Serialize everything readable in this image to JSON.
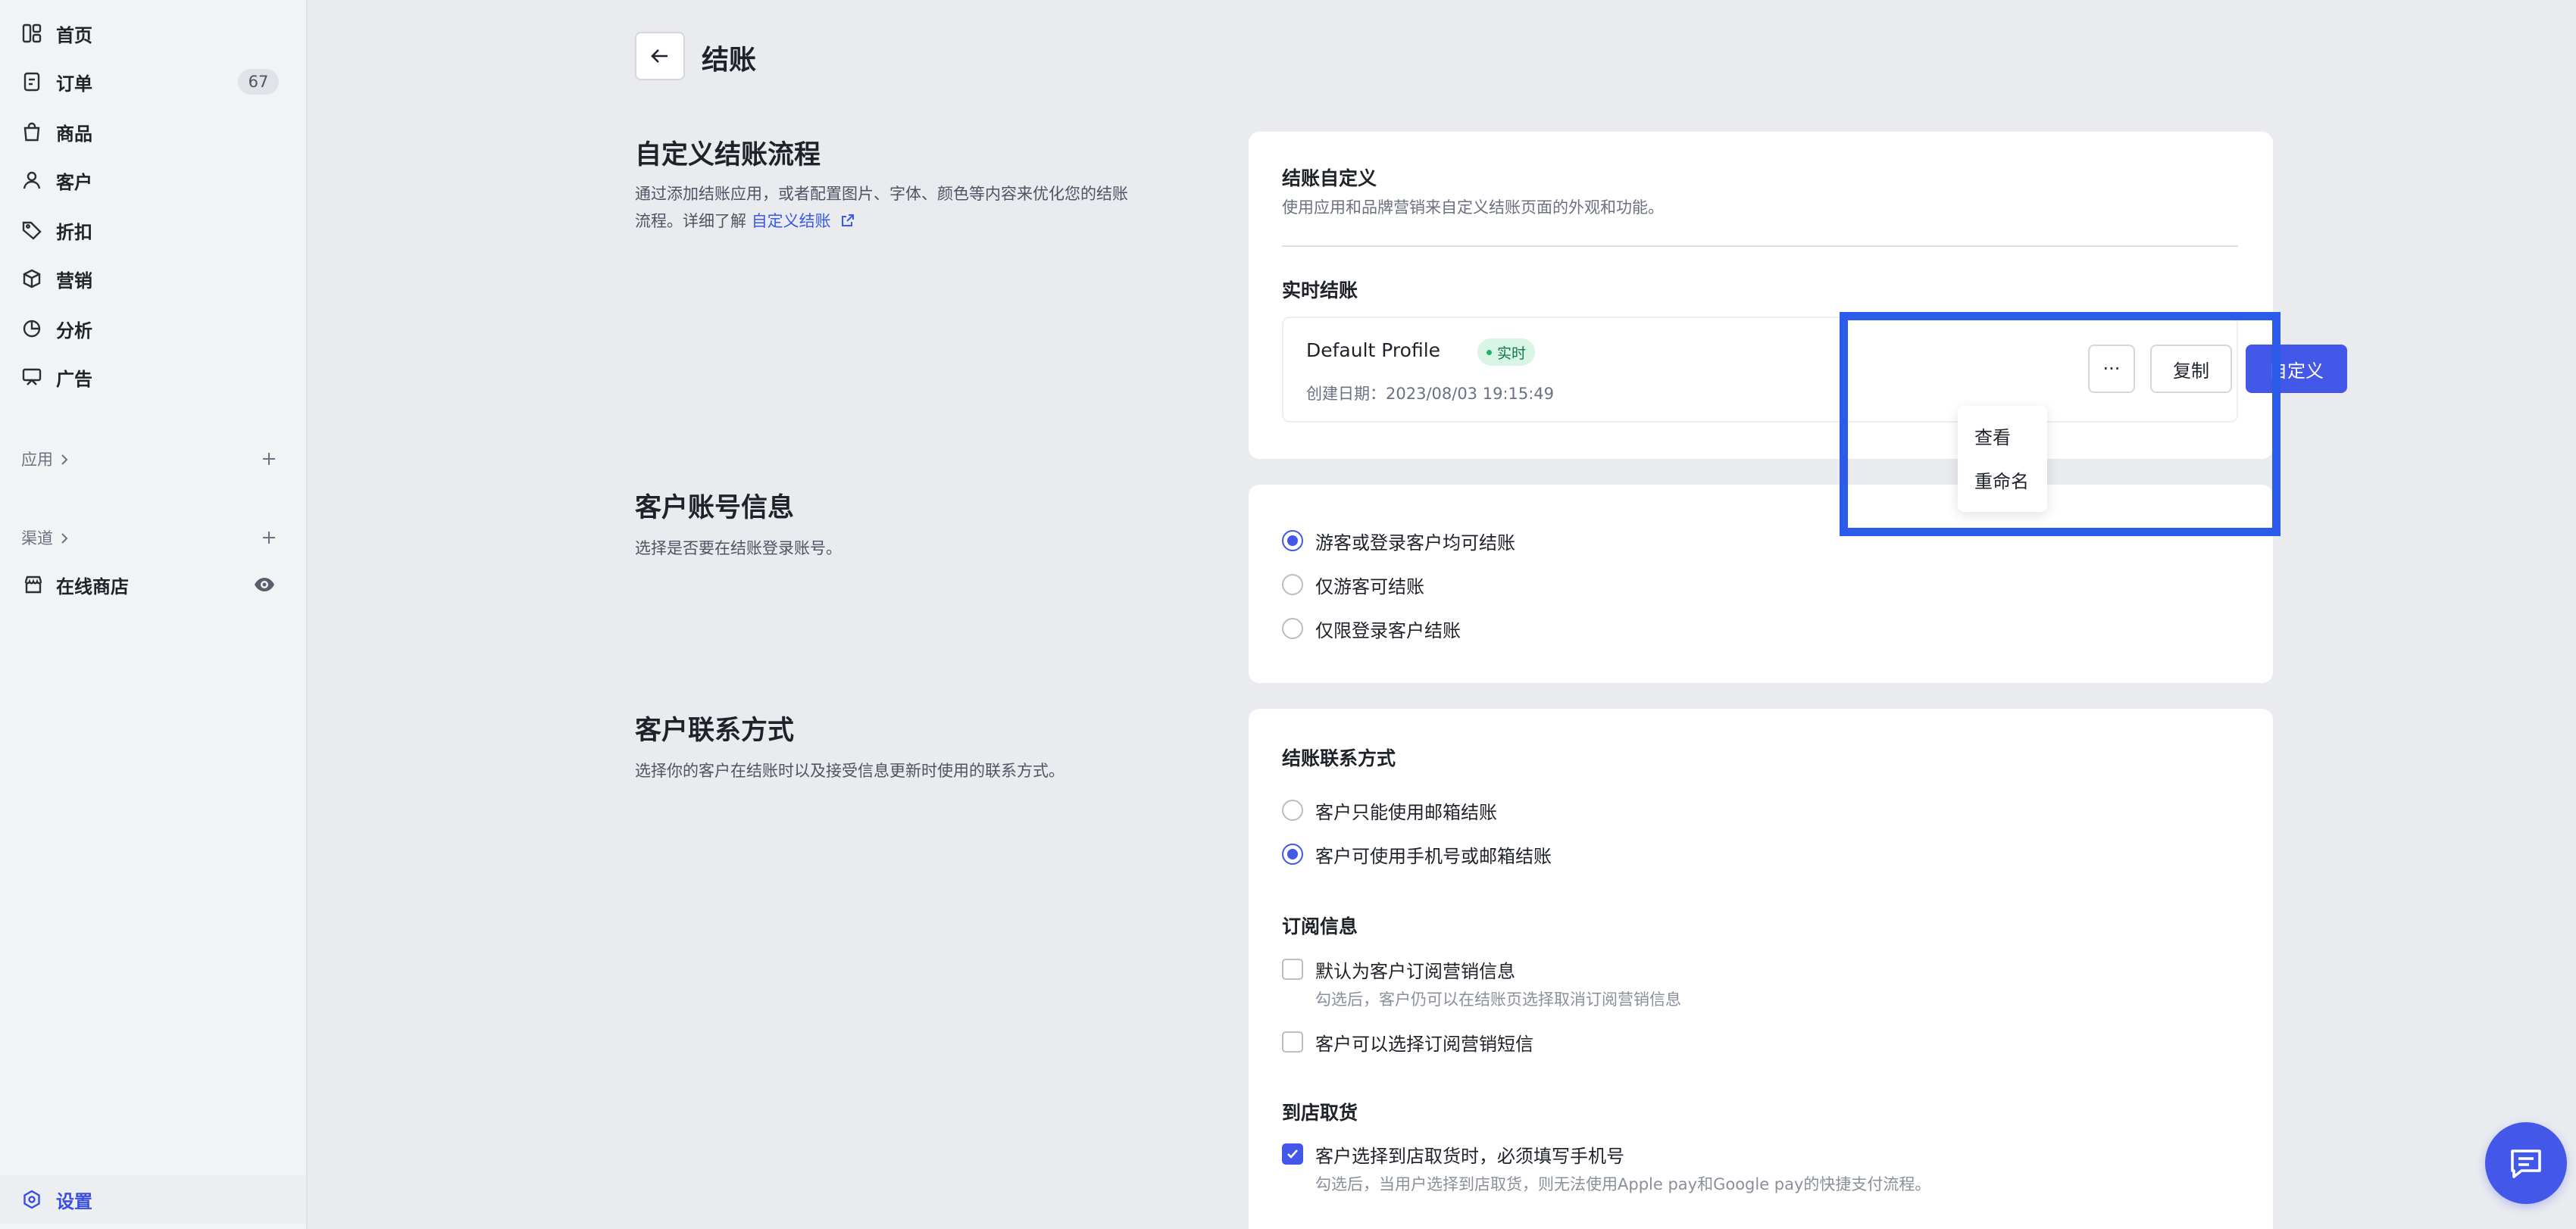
{
  "sidebar": {
    "items": [
      {
        "label": "首页",
        "icon": "home-icon"
      },
      {
        "label": "订单",
        "icon": "orders-icon",
        "badge": "67"
      },
      {
        "label": "商品",
        "icon": "products-icon"
      },
      {
        "label": "客户",
        "icon": "customers-icon"
      },
      {
        "label": "折扣",
        "icon": "discount-icon"
      },
      {
        "label": "营销",
        "icon": "marketing-icon"
      },
      {
        "label": "分析",
        "icon": "analytics-icon"
      },
      {
        "label": "广告",
        "icon": "ads-icon"
      }
    ],
    "apps_label": "应用",
    "channels_label": "渠道",
    "store_label": "在线商店",
    "settings_label": "设置"
  },
  "header": {
    "title": "结账"
  },
  "sections": {
    "custom_checkout": {
      "title": "自定义结账流程",
      "desc_line1": "通过添加结账应用，或者配置图片、字体、颜色等内容来优化您的结账",
      "desc_line2": "流程。详细了解",
      "link": "自定义结账"
    },
    "account": {
      "title": "客户账号信息",
      "desc": "选择是否要在结账登录账号。"
    },
    "contact": {
      "title": "客户联系方式",
      "desc": "选择你的客户在结账时以及接受信息更新时使用的联系方式。"
    }
  },
  "checkout_card": {
    "title": "结账自定义",
    "subtitle": "使用应用和品牌营销来自定义结账页面的外观和功能。",
    "live_label": "实时结账",
    "profile_name": "Default Profile",
    "live_badge": "实时",
    "created_date": "创建日期：2023/08/03 19:15:49",
    "more_label": "···",
    "copy_label": "复制",
    "customize_label": "自定义",
    "menu": [
      "查看",
      "重命名"
    ]
  },
  "account_card": {
    "options": [
      {
        "label": "游客或登录客户均可结账",
        "selected": true
      },
      {
        "label": "仅游客可结账",
        "selected": false
      },
      {
        "label": "仅限登录客户结账",
        "selected": false
      }
    ]
  },
  "contact_card": {
    "contact_title": "结账联系方式",
    "contact_options": [
      {
        "label": "客户只能使用邮箱结账",
        "selected": false
      },
      {
        "label": "客户可使用手机号或邮箱结账",
        "selected": true
      }
    ],
    "subscribe_title": "订阅信息",
    "subscribe_default": "默认为客户订阅营销信息",
    "subscribe_default_hint": "勾选后，客户仍可以在结账页选择取消订阅营销信息",
    "subscribe_sms": "客户可以选择订阅营销短信",
    "pickup_title": "到店取货",
    "pickup_phone": "客户选择到店取货时，必须填写手机号",
    "pickup_hint": "勾选后，当用户选择到店取货，则无法使用Apple pay和Google pay的快捷支付流程。"
  },
  "colors": {
    "accent": "#4357e8",
    "highlight": "#2b5be8",
    "live_badge_bg": "#d9f5e6"
  }
}
